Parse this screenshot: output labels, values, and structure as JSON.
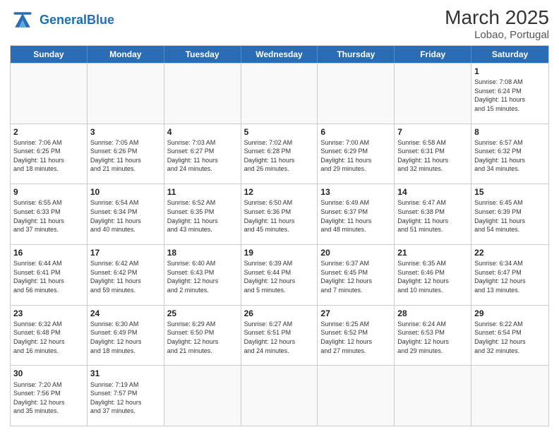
{
  "header": {
    "logo_general": "General",
    "logo_blue": "Blue",
    "month_year": "March 2025",
    "location": "Lobao, Portugal"
  },
  "days_of_week": [
    "Sunday",
    "Monday",
    "Tuesday",
    "Wednesday",
    "Thursday",
    "Friday",
    "Saturday"
  ],
  "weeks": [
    [
      {
        "day": "",
        "info": ""
      },
      {
        "day": "",
        "info": ""
      },
      {
        "day": "",
        "info": ""
      },
      {
        "day": "",
        "info": ""
      },
      {
        "day": "",
        "info": ""
      },
      {
        "day": "",
        "info": ""
      },
      {
        "day": "1",
        "info": "Sunrise: 7:08 AM\nSunset: 6:24 PM\nDaylight: 11 hours\nand 15 minutes."
      }
    ],
    [
      {
        "day": "2",
        "info": "Sunrise: 7:06 AM\nSunset: 6:25 PM\nDaylight: 11 hours\nand 18 minutes."
      },
      {
        "day": "3",
        "info": "Sunrise: 7:05 AM\nSunset: 6:26 PM\nDaylight: 11 hours\nand 21 minutes."
      },
      {
        "day": "4",
        "info": "Sunrise: 7:03 AM\nSunset: 6:27 PM\nDaylight: 11 hours\nand 24 minutes."
      },
      {
        "day": "5",
        "info": "Sunrise: 7:02 AM\nSunset: 6:28 PM\nDaylight: 11 hours\nand 26 minutes."
      },
      {
        "day": "6",
        "info": "Sunrise: 7:00 AM\nSunset: 6:29 PM\nDaylight: 11 hours\nand 29 minutes."
      },
      {
        "day": "7",
        "info": "Sunrise: 6:58 AM\nSunset: 6:31 PM\nDaylight: 11 hours\nand 32 minutes."
      },
      {
        "day": "8",
        "info": "Sunrise: 6:57 AM\nSunset: 6:32 PM\nDaylight: 11 hours\nand 34 minutes."
      }
    ],
    [
      {
        "day": "9",
        "info": "Sunrise: 6:55 AM\nSunset: 6:33 PM\nDaylight: 11 hours\nand 37 minutes."
      },
      {
        "day": "10",
        "info": "Sunrise: 6:54 AM\nSunset: 6:34 PM\nDaylight: 11 hours\nand 40 minutes."
      },
      {
        "day": "11",
        "info": "Sunrise: 6:52 AM\nSunset: 6:35 PM\nDaylight: 11 hours\nand 43 minutes."
      },
      {
        "day": "12",
        "info": "Sunrise: 6:50 AM\nSunset: 6:36 PM\nDaylight: 11 hours\nand 45 minutes."
      },
      {
        "day": "13",
        "info": "Sunrise: 6:49 AM\nSunset: 6:37 PM\nDaylight: 11 hours\nand 48 minutes."
      },
      {
        "day": "14",
        "info": "Sunrise: 6:47 AM\nSunset: 6:38 PM\nDaylight: 11 hours\nand 51 minutes."
      },
      {
        "day": "15",
        "info": "Sunrise: 6:45 AM\nSunset: 6:39 PM\nDaylight: 11 hours\nand 54 minutes."
      }
    ],
    [
      {
        "day": "16",
        "info": "Sunrise: 6:44 AM\nSunset: 6:41 PM\nDaylight: 11 hours\nand 56 minutes."
      },
      {
        "day": "17",
        "info": "Sunrise: 6:42 AM\nSunset: 6:42 PM\nDaylight: 11 hours\nand 59 minutes."
      },
      {
        "day": "18",
        "info": "Sunrise: 6:40 AM\nSunset: 6:43 PM\nDaylight: 12 hours\nand 2 minutes."
      },
      {
        "day": "19",
        "info": "Sunrise: 6:39 AM\nSunset: 6:44 PM\nDaylight: 12 hours\nand 5 minutes."
      },
      {
        "day": "20",
        "info": "Sunrise: 6:37 AM\nSunset: 6:45 PM\nDaylight: 12 hours\nand 7 minutes."
      },
      {
        "day": "21",
        "info": "Sunrise: 6:35 AM\nSunset: 6:46 PM\nDaylight: 12 hours\nand 10 minutes."
      },
      {
        "day": "22",
        "info": "Sunrise: 6:34 AM\nSunset: 6:47 PM\nDaylight: 12 hours\nand 13 minutes."
      }
    ],
    [
      {
        "day": "23",
        "info": "Sunrise: 6:32 AM\nSunset: 6:48 PM\nDaylight: 12 hours\nand 16 minutes."
      },
      {
        "day": "24",
        "info": "Sunrise: 6:30 AM\nSunset: 6:49 PM\nDaylight: 12 hours\nand 18 minutes."
      },
      {
        "day": "25",
        "info": "Sunrise: 6:29 AM\nSunset: 6:50 PM\nDaylight: 12 hours\nand 21 minutes."
      },
      {
        "day": "26",
        "info": "Sunrise: 6:27 AM\nSunset: 6:51 PM\nDaylight: 12 hours\nand 24 minutes."
      },
      {
        "day": "27",
        "info": "Sunrise: 6:25 AM\nSunset: 6:52 PM\nDaylight: 12 hours\nand 27 minutes."
      },
      {
        "day": "28",
        "info": "Sunrise: 6:24 AM\nSunset: 6:53 PM\nDaylight: 12 hours\nand 29 minutes."
      },
      {
        "day": "29",
        "info": "Sunrise: 6:22 AM\nSunset: 6:54 PM\nDaylight: 12 hours\nand 32 minutes."
      }
    ],
    [
      {
        "day": "30",
        "info": "Sunrise: 7:20 AM\nSunset: 7:56 PM\nDaylight: 12 hours\nand 35 minutes."
      },
      {
        "day": "31",
        "info": "Sunrise: 7:19 AM\nSunset: 7:57 PM\nDaylight: 12 hours\nand 37 minutes."
      },
      {
        "day": "",
        "info": ""
      },
      {
        "day": "",
        "info": ""
      },
      {
        "day": "",
        "info": ""
      },
      {
        "day": "",
        "info": ""
      },
      {
        "day": "",
        "info": ""
      }
    ]
  ]
}
